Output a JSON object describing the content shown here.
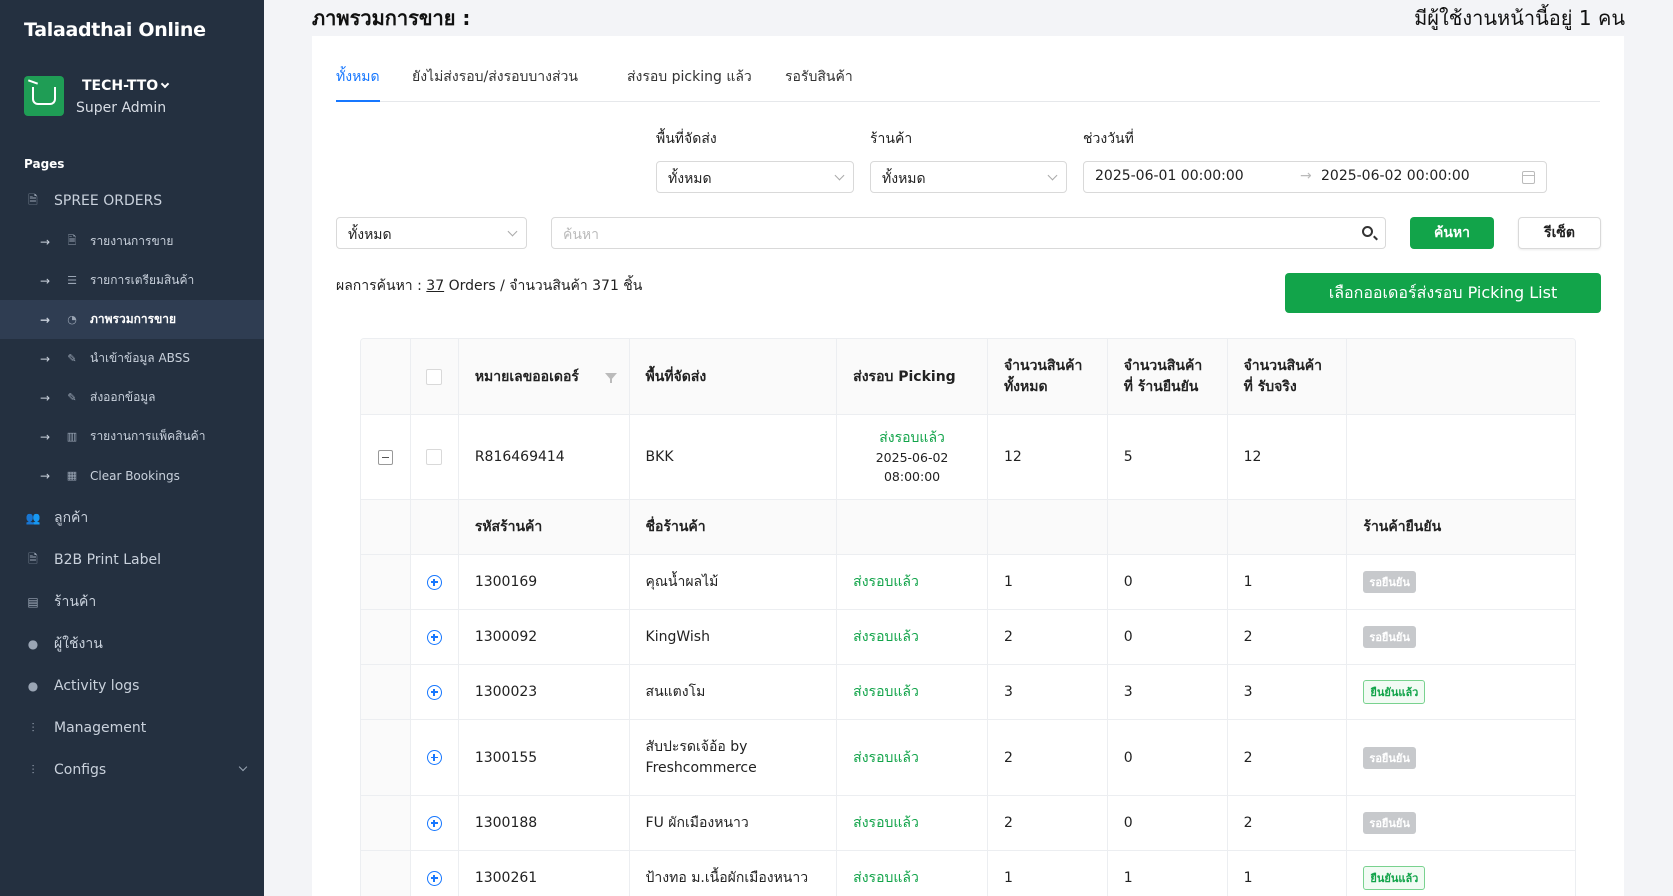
{
  "app": {
    "brand": "Talaadthai Online"
  },
  "profile": {
    "name": "TECH-TTO",
    "role": "Super Admin"
  },
  "sidebar": {
    "pages_label": "Pages",
    "section": "SPREE ORDERS",
    "sub_items": [
      {
        "label": "รายงานการขาย",
        "icon": "file-icon"
      },
      {
        "label": "รายการเตรียมสินค้า",
        "icon": "list-icon"
      },
      {
        "label": "ภาพรวมการขาย",
        "icon": "pie-chart-icon",
        "active": true
      },
      {
        "label": "นำเข้าข้อมูล ABSS",
        "icon": "edit-icon"
      },
      {
        "label": "ส่งออกข้อมูล",
        "icon": "edit-icon"
      },
      {
        "label": "รายงานการแพ็คสินค้า",
        "icon": "barcode-icon"
      },
      {
        "label": "Clear Bookings",
        "icon": "building-icon"
      }
    ],
    "items": [
      {
        "label": "ลูกค้า",
        "icon": "users-icon"
      },
      {
        "label": "B2B Print Label",
        "icon": "file-icon"
      },
      {
        "label": "ร้านค้า",
        "icon": "shop-icon"
      },
      {
        "label": "ผู้ใช้งาน",
        "icon": "user-icon"
      },
      {
        "label": "Activity logs",
        "icon": "user-icon"
      },
      {
        "label": "Management",
        "icon": "sliders-icon"
      },
      {
        "label": "Configs",
        "icon": "sliders-icon"
      }
    ]
  },
  "header": {
    "title": "ภาพรวมการขาย :",
    "online_users": "มีผู้ใช้งานหน้านี้อยู่ 1 คน"
  },
  "tabs": [
    "ทั้งหมด",
    "ยังไม่ส่งรอบ/ส่งรอบบางส่วน",
    "ส่งรอบ picking แล้ว",
    "รอรับสินค้า"
  ],
  "filters": {
    "area_label": "พื้นที่จัดส่ง",
    "area_value": "ทั้งหมด",
    "shop_label": "ร้านค้า",
    "shop_value": "ทั้งหมด",
    "date_label": "ช่วงวันที่",
    "date_from": "2025-06-01 00:00:00",
    "date_to": "2025-06-02 00:00:00",
    "type_value": "ทั้งหมด",
    "search_placeholder": "ค้นหา",
    "search_button": "ค้นหา",
    "reset_button": "รีเซ็ต"
  },
  "result": {
    "prefix": "ผลการค้นหา : ",
    "orders": "37",
    "suffix": " Orders / จำนวนสินค้า 371 ชิ้น"
  },
  "picking_button": "เลือกออเดอร์ส่งรอบ Picking List",
  "table": {
    "columns": [
      "หมายเลขออเดอร์",
      "พื้นที่จัดส่ง",
      "ส่งรอบ Picking",
      "จำนวนสินค้า ทั้งหมด",
      "จำนวนสินค้าที่ ร้านยืนยัน",
      "จำนวนสินค้าที่ รับจริง"
    ],
    "order": {
      "id": "R816469414",
      "area": "BKK",
      "status": "ส่งรอบแล้ว",
      "date": "2025-06-02",
      "time": "08:00:00",
      "total": "12",
      "confirmed": "5",
      "received": "12"
    },
    "sub_columns": [
      "รหัสร้านค้า",
      "ชื่อร้านค้า",
      "ร้านค้ายืนยัน"
    ],
    "sub_rows": [
      {
        "code": "1300169",
        "name": "คุณน้ำผลไม้",
        "status": "ส่งรอบแล้ว",
        "total": "1",
        "confirmed": "0",
        "received": "1",
        "badge": "รอยืนยัน",
        "badge_type": "wait"
      },
      {
        "code": "1300092",
        "name": "KingWish",
        "status": "ส่งรอบแล้ว",
        "total": "2",
        "confirmed": "0",
        "received": "2",
        "badge": "รอยืนยัน",
        "badge_type": "wait"
      },
      {
        "code": "1300023",
        "name": "สนแตงโม",
        "status": "ส่งรอบแล้ว",
        "total": "3",
        "confirmed": "3",
        "received": "3",
        "badge": "ยืนยันแล้ว",
        "badge_type": "ok"
      },
      {
        "code": "1300155",
        "name": "สับปะรดเจ้อ้อ by Freshcommerce",
        "status": "ส่งรอบแล้ว",
        "total": "2",
        "confirmed": "0",
        "received": "2",
        "badge": "รอยืนยัน",
        "badge_type": "wait"
      },
      {
        "code": "1300188",
        "name": "FU ผักเมืองหนาว",
        "status": "ส่งรอบแล้ว",
        "total": "2",
        "confirmed": "0",
        "received": "2",
        "badge": "รอยืนยัน",
        "badge_type": "wait"
      },
      {
        "code": "1300261",
        "name": "ป้างทอ ม.เนื้อผักเมืองหนาว",
        "status": "ส่งรอบแล้ว",
        "total": "1",
        "confirmed": "1",
        "received": "1",
        "badge": "ยืนยันแล้ว",
        "badge_type": "ok"
      }
    ]
  },
  "colors": {
    "sidebar": "#243040",
    "accent": "#12a44a",
    "link": "#1677ff"
  }
}
